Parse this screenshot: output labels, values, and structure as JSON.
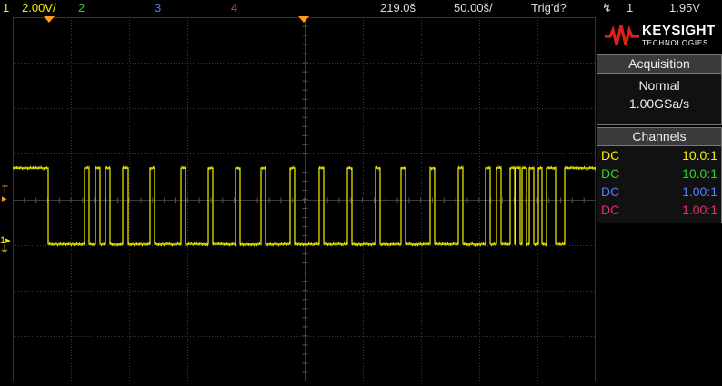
{
  "topbar": {
    "ch1_num": "1",
    "ch1_scale": "2.00V/",
    "ch2_num": "2",
    "ch3_num": "3",
    "ch4_num": "4",
    "timebase": "219.0š",
    "delay": "50.00š/",
    "trig_status": "Trig'd?",
    "trig_source": "1",
    "trig_level": "1.95V"
  },
  "logo": {
    "brand": "KEYSIGHT",
    "sub": "TECHNOLOGIES"
  },
  "acquisition": {
    "title": "Acquisition",
    "mode": "Normal",
    "rate": "1.00GSa/s"
  },
  "channels": {
    "title": "Channels",
    "rows": [
      {
        "coupling": "DC",
        "probe": "10.0:1",
        "color": "#f5f000"
      },
      {
        "coupling": "DC",
        "probe": "10.0:1",
        "color": "#2bd62b"
      },
      {
        "coupling": "DC",
        "probe": "1.00:1",
        "color": "#5a7cff"
      },
      {
        "coupling": "DC",
        "probe": "1.00:1",
        "color": "#e0307a"
      }
    ]
  },
  "colors": {
    "ch1": "#f5f000",
    "ch2": "#2bd62b",
    "ch3": "#5a7cff",
    "ch4": "#e0307a",
    "trigger_marker": "#ff9a1f"
  },
  "markers": {
    "trigger_level_label": "T",
    "ground_label": "1"
  }
}
